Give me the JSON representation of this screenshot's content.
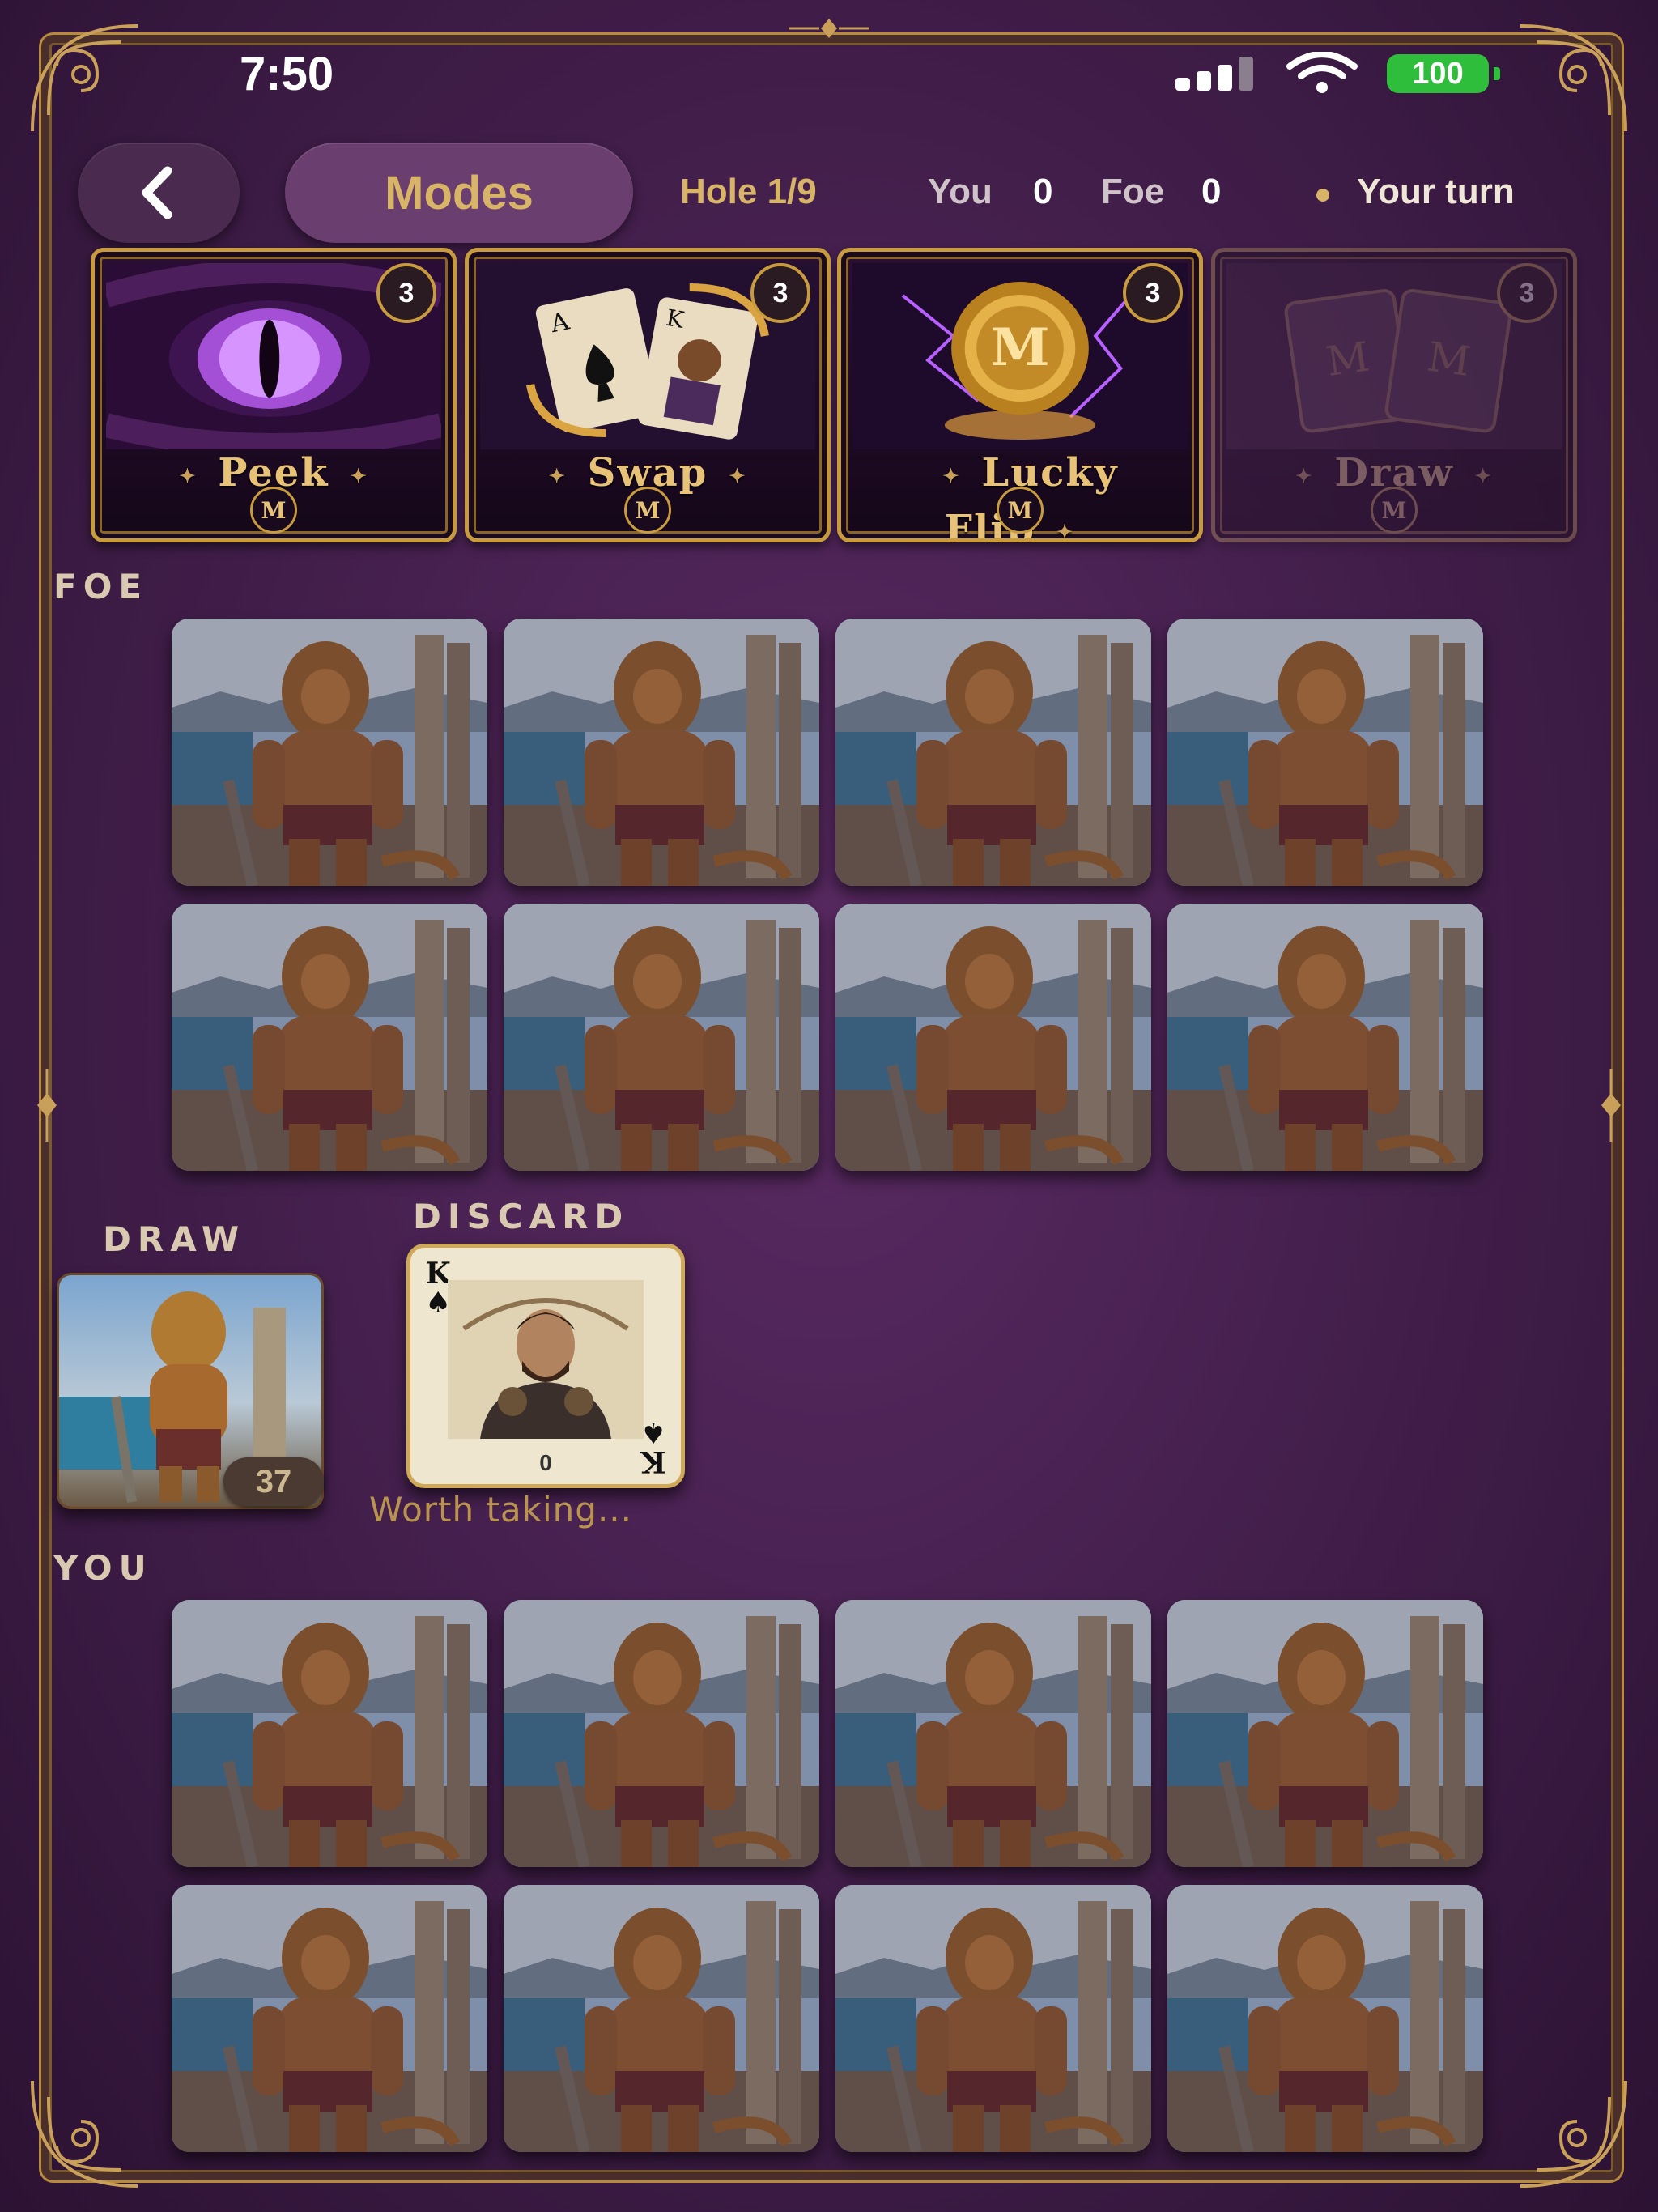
{
  "status": {
    "time": "7:50",
    "battery": "100",
    "signal_bars": 4,
    "signal_active": 3
  },
  "header": {
    "modes_label": "Modes",
    "hole": "Hole 1/9",
    "you_label": "You",
    "you_score": "0",
    "foe_label": "Foe",
    "foe_score": "0",
    "turn_text": "Your turn"
  },
  "powerups": [
    {
      "label": "Peek",
      "count": "3",
      "icon": "dragon-eye-icon",
      "enabled": true
    },
    {
      "label": "Swap",
      "count": "3",
      "icon": "swap-cards-icon",
      "enabled": true
    },
    {
      "label": "Lucky Flip",
      "count": "3",
      "icon": "gold-coin-icon",
      "enabled": true
    },
    {
      "label": "Draw",
      "count": "3",
      "icon": "draw-cards-icon",
      "enabled": false
    }
  ],
  "powerup_medal": "M",
  "foe": {
    "label": "FOE",
    "cards_face_down": 8
  },
  "piles": {
    "draw_label": "DRAW",
    "draw_count": "37",
    "discard_label": "DISCARD",
    "discard_card": {
      "rank": "K",
      "suit": "♠",
      "value": "0"
    },
    "hint": "Worth taking..."
  },
  "you": {
    "label": "YOU",
    "cards_face_down": 8
  },
  "colors": {
    "gold": "#d7b467",
    "background": "#45204e",
    "battery_green": "#2fbe3c"
  }
}
